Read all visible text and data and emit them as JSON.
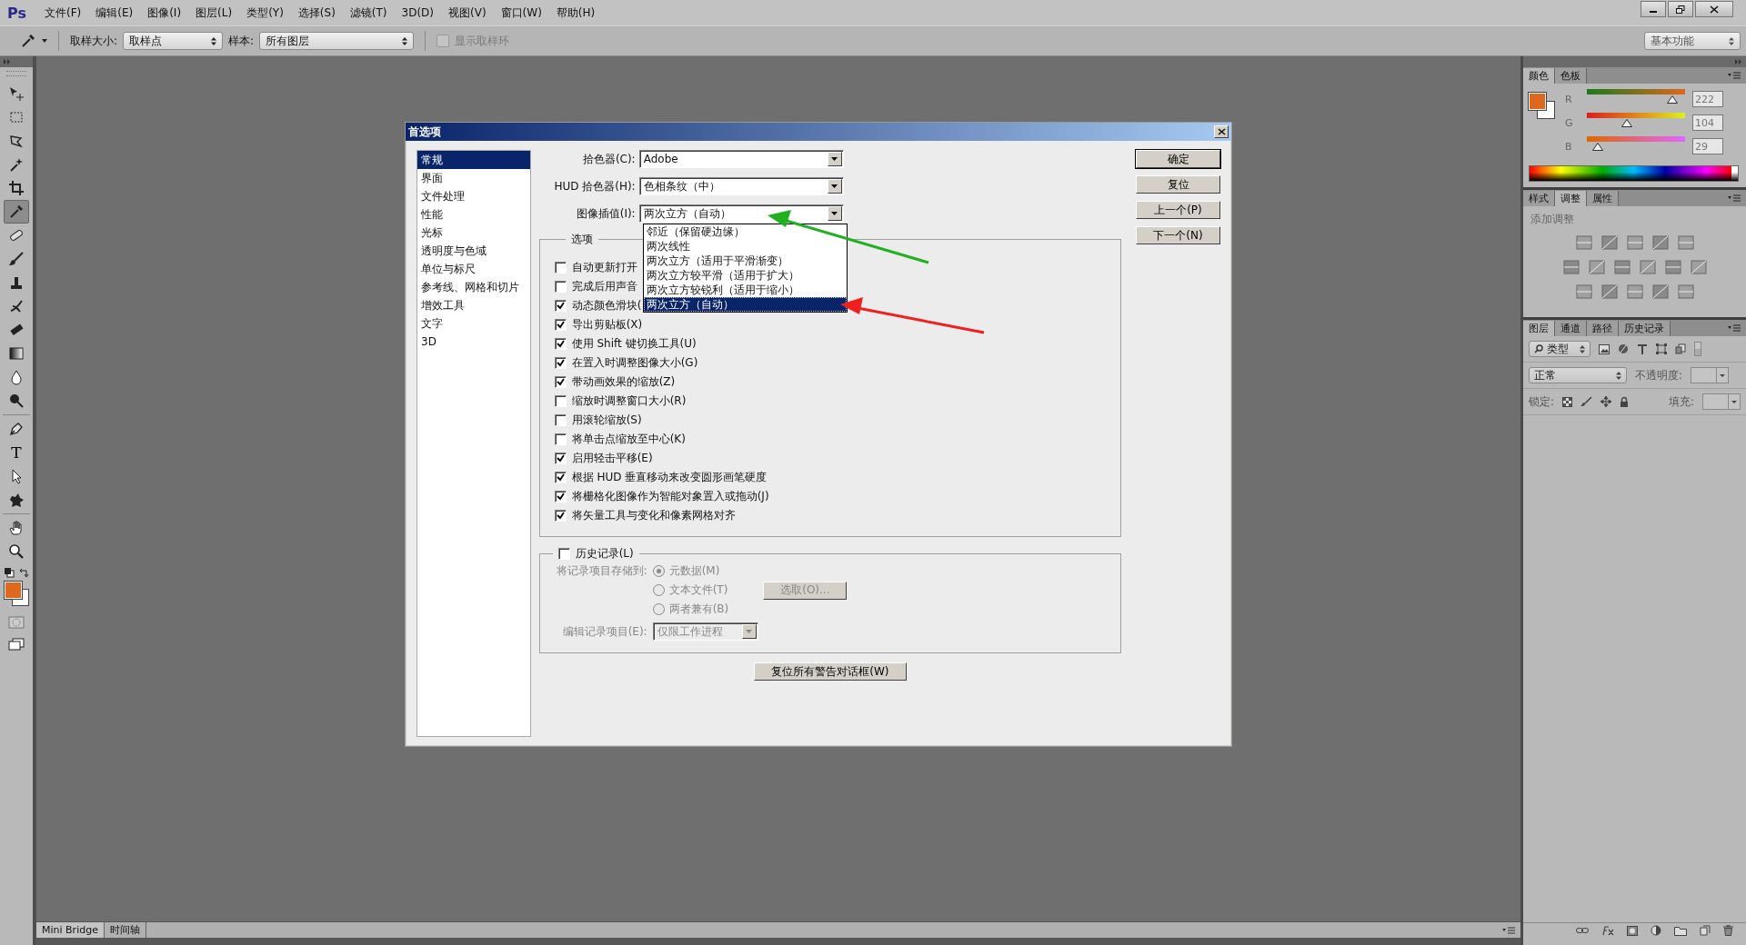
{
  "app": {
    "logo": "Ps"
  },
  "menu": [
    "文件(F)",
    "编辑(E)",
    "图像(I)",
    "图层(L)",
    "类型(Y)",
    "选择(S)",
    "滤镜(T)",
    "3D(D)",
    "视图(V)",
    "窗口(W)",
    "帮助(H)"
  ],
  "options_bar": {
    "sample_size_label": "取样大小:",
    "sample_size": "取样点",
    "sample_label": "样本:",
    "sample": "所有图层",
    "show_ring": {
      "label": "显示取样环",
      "checked": false
    },
    "workspace": "基本功能"
  },
  "tools": [
    {
      "kind": "move",
      "selected": false
    },
    {
      "kind": "marquee",
      "selected": false
    },
    {
      "kind": "lasso",
      "selected": false
    },
    {
      "kind": "wand",
      "selected": false
    },
    {
      "kind": "crop",
      "selected": false
    },
    {
      "kind": "eyedropper",
      "selected": true
    },
    {
      "kind": "healing",
      "selected": false
    },
    {
      "kind": "brush",
      "selected": false
    },
    {
      "kind": "stamp",
      "selected": false
    },
    {
      "kind": "history",
      "selected": false
    },
    {
      "kind": "eraser",
      "selected": false
    },
    {
      "kind": "gradient",
      "selected": false
    },
    {
      "kind": "blur",
      "selected": false
    },
    {
      "kind": "dodge",
      "selected": false
    },
    {
      "kind": "pen",
      "selected": false
    },
    {
      "kind": "type",
      "selected": false,
      "glyph": "T"
    },
    {
      "kind": "select",
      "selected": false
    },
    {
      "kind": "shape",
      "selected": false
    },
    {
      "kind": "hand",
      "selected": false
    },
    {
      "kind": "zoom",
      "selected": false
    }
  ],
  "dialog": {
    "title": "首选项",
    "categories": [
      {
        "label": "常规",
        "selected": true
      },
      {
        "label": "界面",
        "selected": false
      },
      {
        "label": "文件处理",
        "selected": false
      },
      {
        "label": "性能",
        "selected": false
      },
      {
        "label": "光标",
        "selected": false
      },
      {
        "label": "透明度与色域",
        "selected": false
      },
      {
        "label": "单位与标尺",
        "selected": false
      },
      {
        "label": "参考线、网格和切片",
        "selected": false
      },
      {
        "label": "增效工具",
        "selected": false
      },
      {
        "label": "文字",
        "selected": false
      },
      {
        "label": "3D",
        "selected": false
      }
    ],
    "fields": [
      {
        "label": "拾色器(C):",
        "value": "Adobe"
      },
      {
        "label": "HUD 拾色器(H):",
        "value": "色相条纹（中）"
      },
      {
        "label": "图像插值(I):",
        "value": "两次立方（自动）"
      }
    ],
    "interpolation_options": [
      {
        "label": "邻近（保留硬边缘）",
        "selected": false
      },
      {
        "label": "两次线性",
        "selected": false
      },
      {
        "label": "两次立方（适用于平滑渐变）",
        "selected": false
      },
      {
        "label": "两次立方较平滑（适用于扩大）",
        "selected": false
      },
      {
        "label": "两次立方较锐利（适用于缩小）",
        "selected": false
      },
      {
        "label": "两次立方（自动）",
        "selected": true
      }
    ],
    "options_group": {
      "title": "选项",
      "checkboxes": [
        {
          "label": "自动更新打开",
          "checked": false
        },
        {
          "label": "完成后用声音",
          "checked": false
        },
        {
          "label": "动态颜色滑块(",
          "checked": true
        },
        {
          "label": "导出剪贴板(X)",
          "checked": true
        },
        {
          "label": "使用 Shift 键切换工具(U)",
          "checked": true
        },
        {
          "label": "在置入时调整图像大小(G)",
          "checked": true
        },
        {
          "label": "带动画效果的缩放(Z)",
          "checked": true
        },
        {
          "label": "缩放时调整窗口大小(R)",
          "checked": false
        },
        {
          "label": "用滚轮缩放(S)",
          "checked": false
        },
        {
          "label": "将单击点缩放至中心(K)",
          "checked": false
        },
        {
          "label": "启用轻击平移(E)",
          "checked": true
        },
        {
          "label": "根据 HUD 垂直移动来改变圆形画笔硬度",
          "checked": true
        },
        {
          "label": "将栅格化图像作为智能对象置入或拖动(J)",
          "checked": true
        },
        {
          "label": "将矢量工具与变化和像素网格对齐",
          "checked": true
        }
      ]
    },
    "history": {
      "label": "历史记录(L)",
      "checked": false,
      "store_label": "将记录项目存储到:",
      "store_options": [
        {
          "label": "元数据(M)",
          "selected": true
        },
        {
          "label": "文本文件(T)",
          "selected": false
        },
        {
          "label": "两者兼有(B)",
          "selected": false
        }
      ],
      "choose_button": "选取(O)...",
      "edit_label": "编辑记录项目(E):",
      "edit_value": "仅限工作进程"
    },
    "reset_warnings_button": "复位所有警告对话框(W)",
    "buttons": [
      "确定",
      "复位",
      "上一个(P)",
      "下一个(N)"
    ]
  },
  "color_panel": {
    "tabs": [
      {
        "label": "颜色",
        "selected": true
      },
      {
        "label": "色板",
        "selected": false
      }
    ],
    "channels": [
      {
        "name": "R",
        "level": 0.87,
        "reading": "222"
      },
      {
        "name": "G",
        "level": 0.41,
        "reading": "104"
      },
      {
        "name": "B",
        "level": 0.11,
        "reading": "29"
      }
    ]
  },
  "adjustments_panel": {
    "tabs": [
      {
        "label": "样式",
        "selected": false
      },
      {
        "label": "调整",
        "selected": true
      },
      {
        "label": "属性",
        "selected": false
      }
    ],
    "heading": "添加调整"
  },
  "layers_panel": {
    "tabs": [
      {
        "label": "图层",
        "selected": true
      },
      {
        "label": "通道",
        "selected": false
      },
      {
        "label": "路径",
        "selected": false
      },
      {
        "label": "历史记录",
        "selected": false
      }
    ],
    "filter": "类型",
    "blend_mode": "正常",
    "opacity_label": "不透明度:",
    "lock_label": "锁定:",
    "fill_label": "填充:"
  },
  "bottom_tabs": [
    "Mini Bridge",
    "时间轴"
  ]
}
